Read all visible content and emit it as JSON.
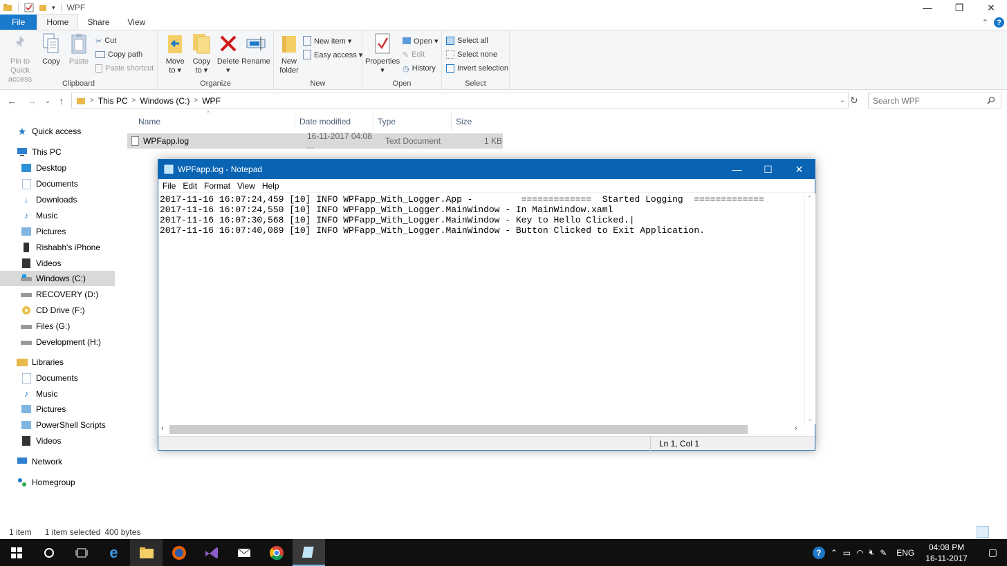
{
  "window": {
    "title": "WPF",
    "controls": {
      "minimize": "—",
      "restore": "❐",
      "close": "✕"
    }
  },
  "ribbon_tabs": [
    {
      "label": "File"
    },
    {
      "label": "Home"
    },
    {
      "label": "Share"
    },
    {
      "label": "View"
    }
  ],
  "ribbon": {
    "clipboard": {
      "label": "Clipboard",
      "pin": "Pin to Quick access",
      "copy": "Copy",
      "paste": "Paste",
      "cut": "Cut",
      "copy_path": "Copy path",
      "paste_shortcut": "Paste shortcut"
    },
    "organize": {
      "label": "Organize",
      "move_to_l1": "Move",
      "move_to_l2": "to ▾",
      "copy_to_l1": "Copy",
      "copy_to_l2": "to ▾",
      "delete_l1": "Delete",
      "delete_l2": "▾",
      "rename": "Rename"
    },
    "new": {
      "label": "New",
      "new_folder_l1": "New",
      "new_folder_l2": "folder",
      "new_item": "New item ▾",
      "easy_access": "Easy access ▾"
    },
    "open": {
      "label": "Open",
      "properties_l1": "Properties",
      "properties_l2": "▾",
      "open": "Open ▾",
      "edit": "Edit",
      "history": "History"
    },
    "select": {
      "label": "Select",
      "select_all": "Select all",
      "select_none": "Select none",
      "invert": "Invert selection"
    }
  },
  "address": {
    "crumbs": [
      "This PC",
      "Windows (C:)",
      "WPF"
    ],
    "search_placeholder": "Search WPF"
  },
  "sidebar": {
    "quick_access": "Quick access",
    "this_pc": "This PC",
    "this_pc_items": [
      "Desktop",
      "Documents",
      "Downloads",
      "Music",
      "Pictures",
      "Rishabh's iPhone",
      "Videos",
      "Windows (C:)",
      "RECOVERY (D:)",
      "CD Drive (F:)",
      "Files (G:)",
      "Development (H:)"
    ],
    "libraries": "Libraries",
    "library_items": [
      "Documents",
      "Music",
      "Pictures",
      "PowerShell Scripts",
      "Videos"
    ],
    "network": "Network",
    "homegroup": "Homegroup"
  },
  "file_list": {
    "columns": [
      "Name",
      "Date modified",
      "Type",
      "Size"
    ],
    "rows": [
      {
        "name": "WPFapp.log",
        "date": "16-11-2017 04:08 ...",
        "type": "Text Document",
        "size": "1 KB"
      }
    ]
  },
  "status": {
    "items": "1 item",
    "selected": "1 item selected",
    "bytes": "400 bytes"
  },
  "notepad": {
    "title": "WPFapp.log - Notepad",
    "menu": [
      "File",
      "Edit",
      "Format",
      "View",
      "Help"
    ],
    "lines": [
      "2017-11-16 16:07:24,459 [10] INFO WPFapp_With_Logger.App -         =============  Started Logging  =============",
      "2017-11-16 16:07:24,550 [10] INFO WPFapp_With_Logger.MainWindow - In MainWindow.xaml",
      "2017-11-16 16:07:30,568 [10] INFO WPFapp_With_Logger.MainWindow - Key to Hello Clicked.|",
      "2017-11-16 16:07:40,089 [10] INFO WPFapp_With_Logger.MainWindow - Button Clicked to Exit Application."
    ],
    "status": "Ln 1, Col 1"
  },
  "taskbar": {
    "lang": "ENG",
    "time": "04:08 PM",
    "date": "16-11-2017"
  }
}
